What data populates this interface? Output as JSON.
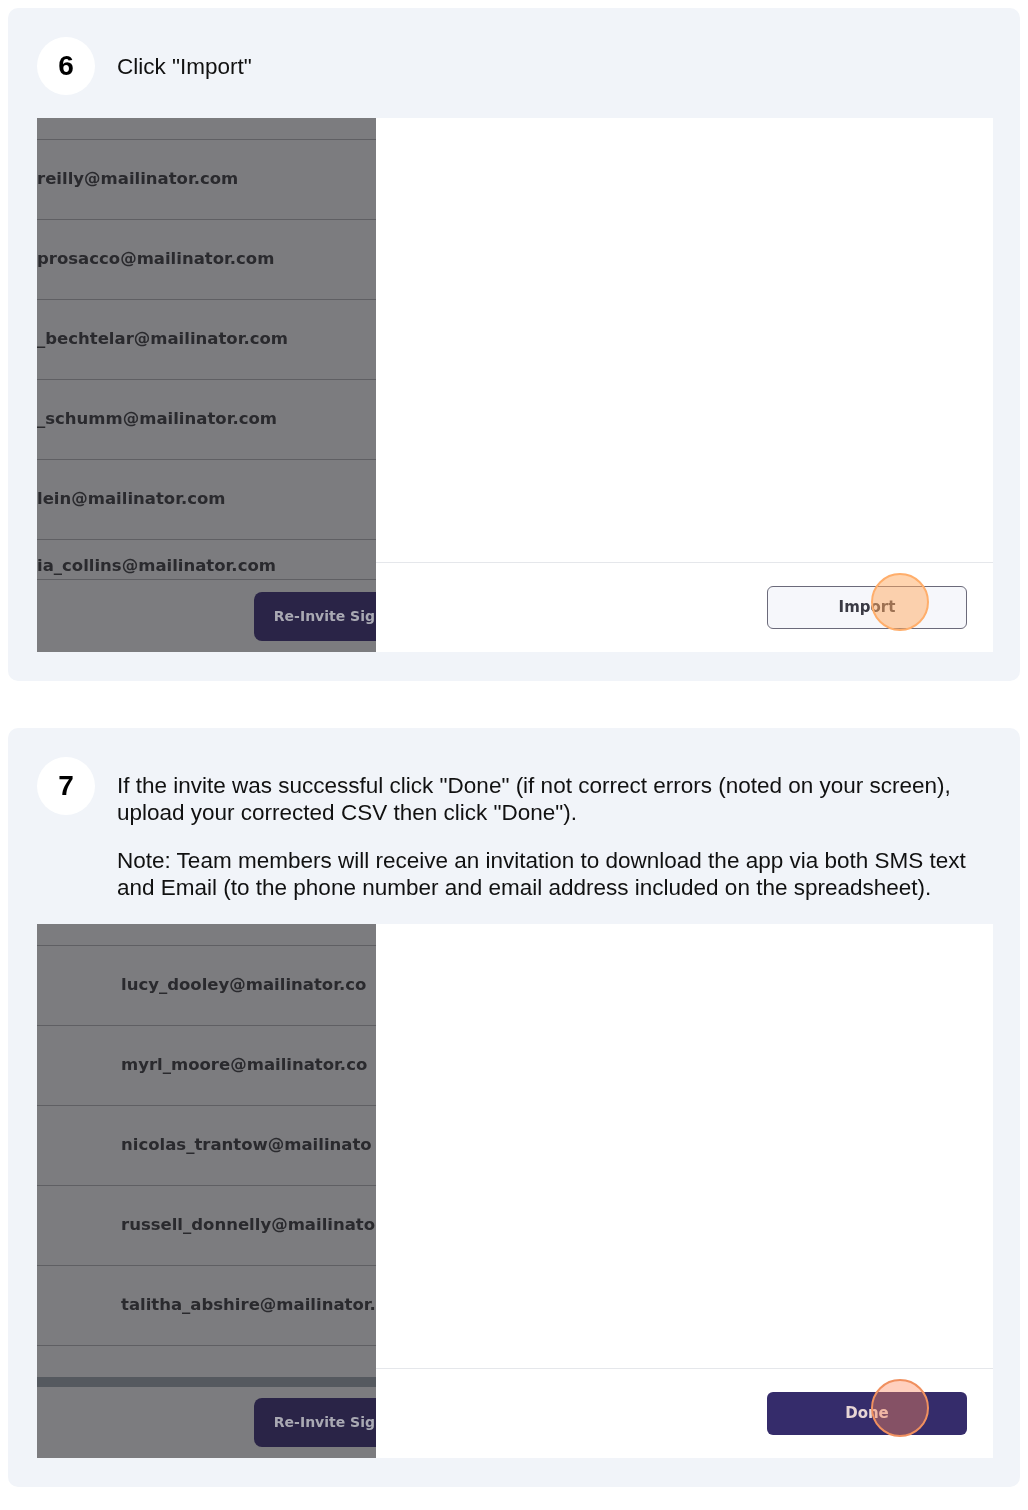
{
  "steps": [
    {
      "number": "6",
      "paragraphs": [
        "Click \"Import\""
      ],
      "screenshot": {
        "kind": "clipped",
        "scrollbar": false,
        "rows": [
          "reilly@mailinator.com",
          "prosacco@mailinator.com",
          "_bechtelar@mailinator.com",
          "_schumm@mailinator.com",
          "lein@mailinator.com",
          "ia_collins@mailinator.com"
        ],
        "side_button": "Re-Invite Sig",
        "action_button": {
          "label": "Import",
          "kind": "outline"
        }
      }
    },
    {
      "number": "7",
      "paragraphs": [
        "If the invite was successful click \"Done\" (if not correct errors (noted on your screen), upload your corrected CSV then click \"Done\").",
        "Note: Team members will receive an invitation to download the app via both SMS text and Email (to the phone number and email address included on the spreadsheet)."
      ],
      "screenshot": {
        "kind": "indented",
        "scrollbar": true,
        "rows": [
          "lucy_dooley@mailinator.co",
          "myrl_moore@mailinator.co",
          "nicolas_trantow@mailinato",
          "russell_donnelly@mailinato",
          "talitha_abshire@mailinator."
        ],
        "side_button": "Re-Invite Sig",
        "action_button": {
          "label": "Done",
          "kind": "primary"
        }
      }
    }
  ]
}
